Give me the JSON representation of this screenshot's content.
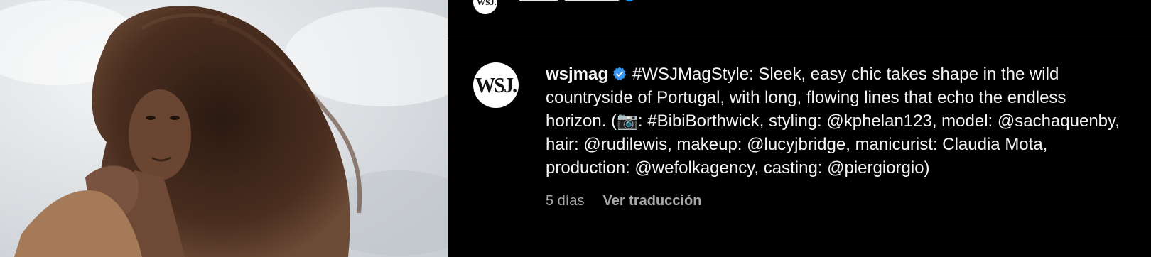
{
  "post": {
    "author": {
      "username": "wsjmag",
      "avatar_text": "WSJ.",
      "verified": true
    },
    "caption_text": "#WSJMagStyle: Sleek, easy chic takes shape in the wild countryside of Portugal, with long, flowing lines that echo the endless horizon. (📷: #BibiBorthwick, styling: @kphelan123, model: @sachaquenby, hair: @rudilewis, makeup: @lucyjbridge, manicurist: Claudia Mota, production: @wefolkagency, casting: @piergiorgio)",
    "time_ago": "5 días",
    "translate_label": "Ver traducción"
  },
  "header": {
    "avatar_text": "WSJ."
  },
  "colors": {
    "background": "#000000",
    "text_primary": "#f5f5f5",
    "text_secondary": "#a8a8a8",
    "verified_blue": "#3897f0",
    "link_blue": "#0095f6"
  },
  "icons": {
    "verified": "verified-badge-icon"
  }
}
